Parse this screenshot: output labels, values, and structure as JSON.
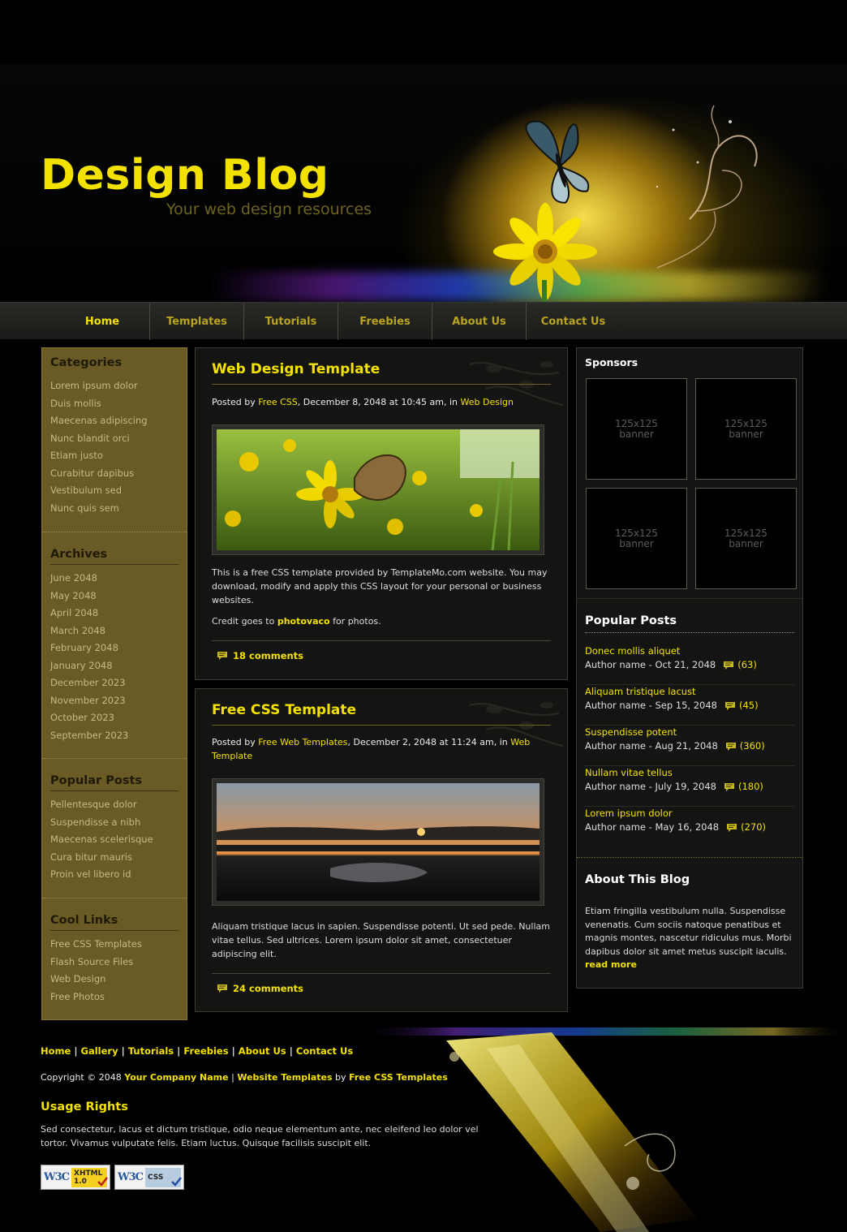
{
  "header": {
    "title": "Design Blog",
    "slogan": "Your web design resources"
  },
  "nav": {
    "items": [
      "Home",
      "Templates",
      "Tutorials",
      "Freebies",
      "About Us",
      "Contact Us"
    ],
    "active": "Home"
  },
  "left_sidebar": {
    "categories": {
      "title": "Categories",
      "items": [
        "Lorem ipsum dolor",
        "Duis mollis",
        "Maecenas adipiscing",
        "Nunc blandit orci",
        "Etiam justo",
        "Curabitur dapibus",
        "Vestibulum sed",
        "Nunc quis sem"
      ]
    },
    "archives": {
      "title": "Archives",
      "items": [
        "June 2048",
        "May 2048",
        "April 2048",
        "March 2048",
        "February 2048",
        "January 2048",
        "December 2023",
        "November 2023",
        "October 2023",
        "September 2023"
      ]
    },
    "popular": {
      "title": "Popular Posts",
      "items": [
        "Pellentesque dolor",
        "Suspendisse a nibh",
        "Maecenas scelerisque",
        "Cura bitur mauris",
        "Proin vel libero id"
      ]
    },
    "links": {
      "title": "Cool Links",
      "items": [
        "Free CSS Templates",
        "Flash Source Files",
        "Web Design",
        "Free Photos"
      ]
    }
  },
  "posts": [
    {
      "title": "Web Design Template",
      "meta_prefix": "Posted by ",
      "author": "Free CSS",
      "meta_mid": ", December 8, 2048 at 10:45 am, in ",
      "category": "Web Design",
      "body": "This is a free CSS template provided by TemplateMo.com website. You may download, modify and apply this CSS layout for your personal or business websites.",
      "credit_prefix": "Credit goes to ",
      "credit_link": "photovaco",
      "credit_suffix": " for photos.",
      "comments": "18 comments"
    },
    {
      "title": "Free CSS Template",
      "meta_prefix": "Posted by ",
      "author": "Free Web Templates",
      "meta_mid": ", December 2, 2048 at 11:24 am, in ",
      "category": "Web Template",
      "body": "Aliquam tristique lacus in sapien. Suspendisse potenti. Ut sed pede. Nullam vitae tellus. Sed ultrices. Lorem ipsum dolor sit amet, consectetuer adipiscing elit.",
      "comments": "24 comments"
    }
  ],
  "right_sidebar": {
    "sponsors_title": "Sponsors",
    "banner_line1": "125x125",
    "banner_line2": "banner",
    "popular_title": "Popular Posts",
    "popular": [
      {
        "title": "Donec mollis aliquet",
        "author": "Author name - Oct 21, 2048",
        "count": "(63)"
      },
      {
        "title": "Aliquam tristique lacust",
        "author": "Author name - Sep 15, 2048",
        "count": "(45)"
      },
      {
        "title": "Suspendisse potent",
        "author": "Author name - Aug 21, 2048",
        "count": "(360)"
      },
      {
        "title": "Nullam vitae tellus",
        "author": "Author name - July 19, 2048",
        "count": "(180)"
      },
      {
        "title": "Lorem ipsum dolor",
        "author": "Author name - May 16, 2048",
        "count": "(270)"
      }
    ],
    "about_title": "About This Blog",
    "about_text": "Etiam fringilla vestibulum nulla. Suspendisse venenatis. Cum sociis natoque penatibus et magnis montes, nascetur ridiculus mus. Morbi dapibus dolor sit amet metus suscipit iaculis.",
    "read_more": "read more"
  },
  "footer": {
    "links": [
      "Home",
      "Gallery",
      "Tutorials",
      "Freebies",
      "About Us",
      "Contact Us"
    ],
    "separator": " | ",
    "copyright_prefix": "Copyright © 2048 ",
    "company": "Your Company Name",
    "website_templates": "Website Templates",
    "by": " by ",
    "free_css": "Free CSS Templates",
    "usage_title": "Usage Rights",
    "usage_text": "Sed consectetur, lacus et dictum tristique, odio neque elementum ante, nec eleifend leo dolor vel tortor. Vivamus vulputate felis. Etiam luctus. Quisque facilisis suscipit elit.",
    "badge_xhtml": {
      "logo": "W3C",
      "line1": "XHTML",
      "line2": "1.0"
    },
    "badge_css": {
      "logo": "W3C",
      "line1": "CSS"
    }
  },
  "colors": {
    "accent": "#f3e200",
    "sidebar_bg": "#6a5a25",
    "panel_bg": "#141412"
  }
}
